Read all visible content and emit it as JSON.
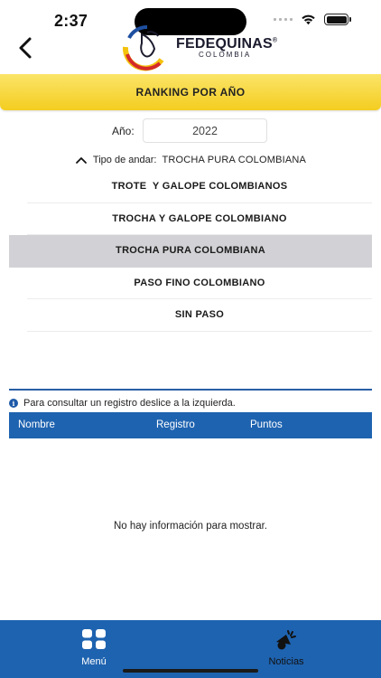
{
  "status_bar": {
    "time": "2:37"
  },
  "header": {
    "logo_name": "FEDEQUINAS",
    "logo_mark": "®",
    "logo_sub": "COLOMBIA"
  },
  "banner": {
    "title": "RANKING POR AÑO"
  },
  "year": {
    "label": "Año:",
    "value": "2022"
  },
  "tipo": {
    "label": "Tipo de andar:",
    "value": "TROCHA PURA COLOMBIANA"
  },
  "options": [
    {
      "label": "TROTE  Y GALOPE COLOMBIANOS",
      "selected": false
    },
    {
      "label": "TROCHA Y GALOPE COLOMBIANO",
      "selected": false
    },
    {
      "label": "TROCHA PURA COLOMBIANA",
      "selected": true
    },
    {
      "label": "PASO FINO COLOMBIANO",
      "selected": false
    },
    {
      "label": "SIN PASO",
      "selected": false
    }
  ],
  "hint": {
    "icon": "i",
    "text": "Para consultar un registro deslice a la izquierda."
  },
  "table": {
    "columns": [
      "Nombre",
      "Registro",
      "Puntos"
    ],
    "empty_message": "No hay información para mostrar."
  },
  "bottom_nav": {
    "menu_label": "Menú",
    "news_label": "Noticias"
  },
  "colors": {
    "primary_blue": "#1e63b0",
    "banner_yellow": "#f4cd20",
    "selected_row": "#d2d2d6"
  },
  "icons": [
    "back-chevron-icon",
    "wifi-icon",
    "battery-icon",
    "chevron-up-icon",
    "info-icon",
    "grid-menu-icon",
    "megaphone-icon"
  ]
}
